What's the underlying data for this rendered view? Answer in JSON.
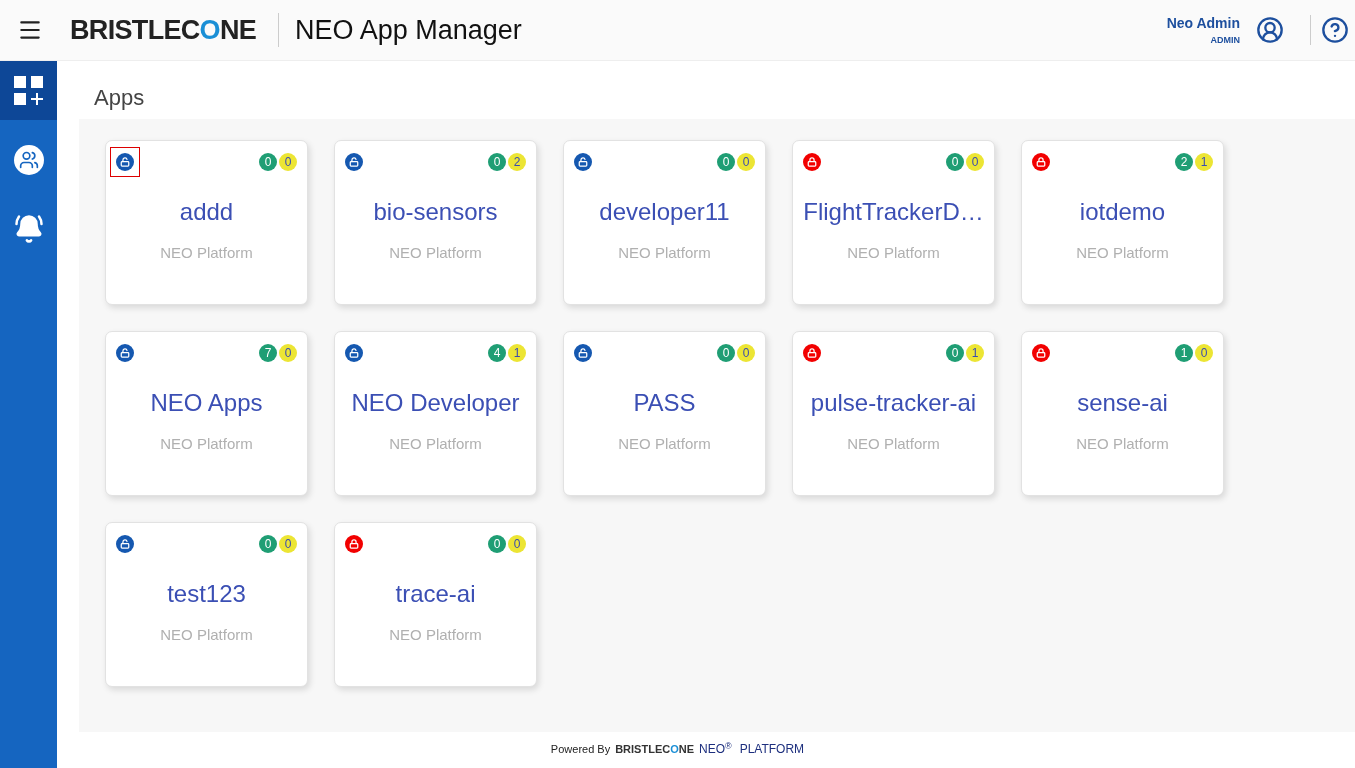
{
  "header": {
    "logo": {
      "before": "BRISTLEC",
      "mark": "O",
      "after": "NE"
    },
    "title": "NEO App Manager",
    "user": {
      "name": "Neo Admin",
      "role": "ADMIN"
    }
  },
  "sidebar": {
    "items": [
      {
        "kind": "apps",
        "selected": true
      },
      {
        "kind": "users",
        "selected": false
      },
      {
        "kind": "bell",
        "selected": false
      }
    ]
  },
  "page_title": "Apps",
  "apps": [
    {
      "name": "addd",
      "platform": "NEO Platform",
      "locked": false,
      "focused": true,
      "green": "0",
      "yellow": "0"
    },
    {
      "name": "bio-sensors",
      "platform": "NEO Platform",
      "locked": false,
      "focused": false,
      "green": "0",
      "yellow": "2"
    },
    {
      "name": "developer11",
      "platform": "NEO Platform",
      "locked": false,
      "focused": false,
      "green": "0",
      "yellow": "0"
    },
    {
      "name": "FlightTrackerD…",
      "platform": "NEO Platform",
      "locked": true,
      "focused": false,
      "green": "0",
      "yellow": "0"
    },
    {
      "name": "iotdemo",
      "platform": "NEO Platform",
      "locked": true,
      "focused": false,
      "green": "2",
      "yellow": "1"
    },
    {
      "name": "NEO Apps",
      "platform": "NEO Platform",
      "locked": false,
      "focused": false,
      "green": "7",
      "yellow": "0"
    },
    {
      "name": "NEO Developer",
      "platform": "NEO Platform",
      "locked": false,
      "focused": false,
      "green": "4",
      "yellow": "1"
    },
    {
      "name": "PASS",
      "platform": "NEO Platform",
      "locked": false,
      "focused": false,
      "green": "0",
      "yellow": "0"
    },
    {
      "name": "pulse-tracker-ai",
      "platform": "NEO Platform",
      "locked": true,
      "focused": false,
      "green": "0",
      "yellow": "1"
    },
    {
      "name": "sense-ai",
      "platform": "NEO Platform",
      "locked": true,
      "focused": false,
      "green": "1",
      "yellow": "0"
    },
    {
      "name": "test123",
      "platform": "NEO Platform",
      "locked": false,
      "focused": false,
      "green": "0",
      "yellow": "0"
    },
    {
      "name": "trace-ai",
      "platform": "NEO Platform",
      "locked": true,
      "focused": false,
      "green": "0",
      "yellow": "0"
    }
  ],
  "footer": {
    "powered": "Powered By",
    "logo": {
      "before": "BRISTLEC",
      "mark": "O",
      "after": "NE"
    },
    "neo": "NEO",
    "sup": "®",
    "platform": "PLATFORM"
  }
}
